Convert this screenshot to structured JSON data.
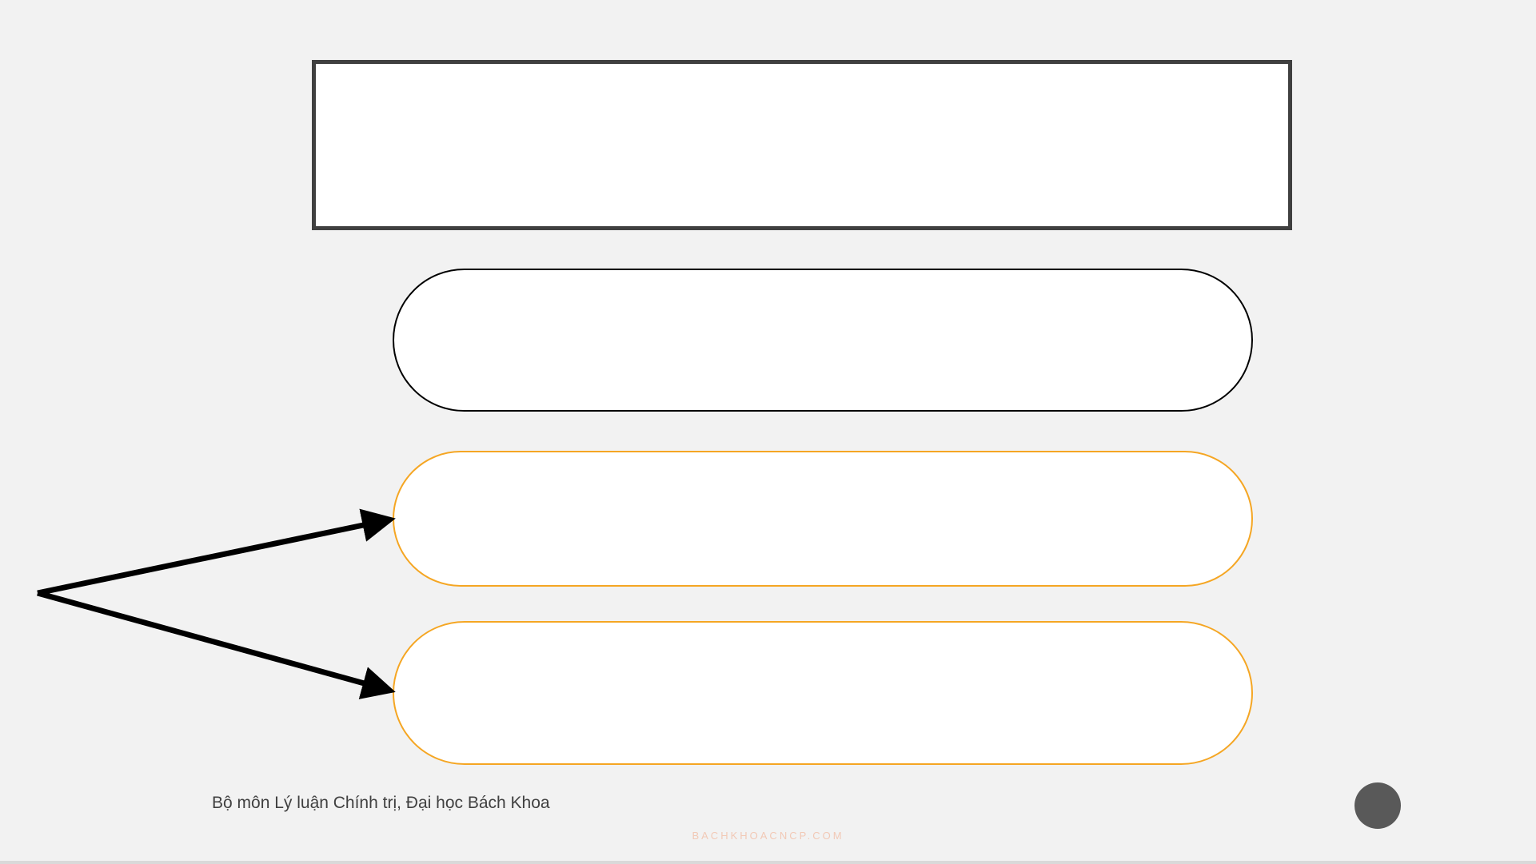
{
  "slide": {
    "footer_text": "Bộ môn Lý luận Chính trị, Đại học Bách Khoa",
    "watermark": "BACHKHOACNCP.COM"
  },
  "colors": {
    "background": "#f2f2f2",
    "title_border": "#404040",
    "pill_border_black": "#000000",
    "pill_border_orange": "#f5a623",
    "page_dot": "#595959",
    "watermark": "#f2c9b6"
  }
}
